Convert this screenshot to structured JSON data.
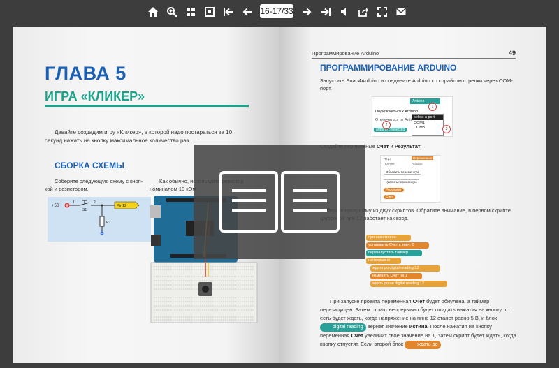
{
  "toolbar": {
    "page_indicator": "16-17/33",
    "buttons": [
      "home-icon",
      "zoom-icon",
      "thumbnails-icon",
      "single-page-icon",
      "first-page-icon",
      "prev-page-icon",
      "next-page-icon",
      "last-page-icon",
      "sound-icon",
      "share-icon",
      "fullscreen-icon",
      "email-icon"
    ]
  },
  "left_page": {
    "chapter_title": "ГЛАВА 5",
    "chapter_subtitle": "ИГРА «КЛИКЕР»",
    "intro": "Давайте создадим игру «Кликер», в которой надо постараться за 10 секунд на­жать на кнопку максимальное количество раз.",
    "section_title": "СБОРКА СХЕМЫ",
    "col1": "Соберите следующую схему с кноп­кой и резистором.",
    "col2": "Как обычно, используйте резистор номиналом 10 кОм.",
    "schematic": {
      "vcc": "+5В",
      "s1": "S1",
      "n1": "1",
      "n2": "2",
      "r1": "R1",
      "pin": "Pin12"
    }
  },
  "right_page": {
    "running_title": "Программирование Arduino",
    "page_number": "49",
    "section_title": "ПРОГРАММИРОВАНИЕ ARDUINO",
    "p1": "Запустите Snap4Arduino и соедините Arduino со спрайтом стрелки через COM-порт.",
    "port_ui": {
      "tab": "Arduino",
      "connect": "Подключиться к Arduino",
      "disconnect": "Отключиться от Arduino",
      "connected": "arduino connected",
      "select_port": "select a port",
      "com1": "COM1",
      "com3": "COM3",
      "n1": "1",
      "n2": "2",
      "n3": "3"
    },
    "p2_prefix": "Создайте переменные ",
    "p2_var1": "Счет",
    "p2_and": " и ",
    "p2_var2": "Результат",
    "p2_suffix": ".",
    "vars_ui": {
      "tab1": "Перо",
      "tab2": "Переменные",
      "tab3": "Прочее",
      "tab4": "Arduino",
      "btn1": "Объявить переменную",
      "btn2": "Удалить переменную",
      "var1": "Результат",
      "var2": "Счет"
    },
    "p3": "Соберите программу из двух скриптов. Обратите внимание, в первом скрипте цифровой пин 12 работает как вход.",
    "script": {
      "b1": "при нажатии на",
      "b2": "установить Счет в знач. 0",
      "b3": "перезапустить таймер",
      "b4": "непрерывно",
      "b5": "ждать до digital reading 12",
      "b6": "изменить Счет на 1",
      "b7": "ждать до не digital reading 12"
    },
    "p4_a": "При запуске проекта переменная ",
    "p4_b": "Счет",
    "p4_c": " будет обнулена, а таймер перезапущен. Затем скрипт непрерывно будет ожидать нажатия на кнопку, то есть будет ждать, когда напряжение на пине 12 станет равно 5 В, и блок ",
    "p4_block": "digital reading",
    "p4_d": " вернет зна­чение ",
    "p4_e": "истина",
    "p4_f": ". После нажатия на кнопку переменная ",
    "p4_g": "Счет",
    "p4_h": " увеличит свое значение на 1, затем скрипт будет ждать, когда кнопку отпустят. Если второй блок ",
    "p4_block2": "ждать до"
  }
}
